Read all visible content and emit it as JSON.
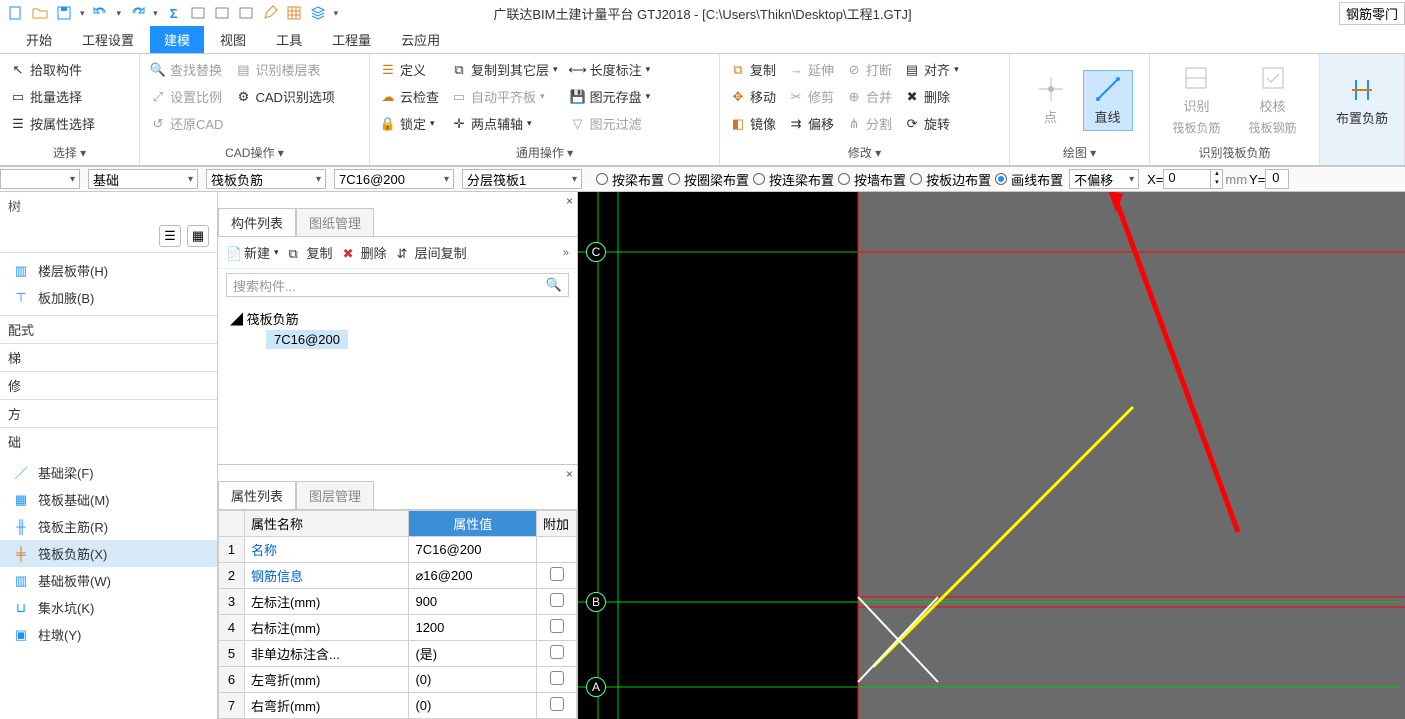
{
  "title": "广联达BIM土建计量平台 GTJ2018 - [C:\\Users\\Thikn\\Desktop\\工程1.GTJ]",
  "rightEdge": "钢筋零门",
  "mainTabs": [
    "开始",
    "工程设置",
    "建模",
    "视图",
    "工具",
    "工程量",
    "云应用"
  ],
  "activeMainTab": 2,
  "ribbon": {
    "select": {
      "label": "选择 ▾",
      "items": [
        "拾取构件",
        "批量选择",
        "按属性选择"
      ]
    },
    "cad": {
      "label": "CAD操作 ▾",
      "items": [
        "查找替换",
        "设置比例",
        "还原CAD",
        "识别楼层表",
        "CAD识别选项"
      ]
    },
    "common": {
      "label": "通用操作 ▾",
      "colA": [
        "定义",
        "云检查",
        "锁定"
      ],
      "colB": [
        "复制到其它层",
        "自动平齐板",
        "两点辅轴"
      ],
      "colC": [
        "长度标注",
        "图元存盘",
        "图元过滤"
      ]
    },
    "edit": {
      "label": "修改 ▾",
      "colA": [
        "复制",
        "移动",
        "镜像"
      ],
      "colB": [
        "延伸",
        "修剪",
        "偏移"
      ],
      "colC": [
        "打断",
        "合并",
        "分割"
      ],
      "colD": [
        "对齐",
        "删除",
        "旋转"
      ]
    },
    "draw": {
      "label": "绘图 ▾",
      "point": "点",
      "line": "直线"
    },
    "recog": {
      "label": "识别筏板负筋",
      "a": "识别",
      "asub": "筏板负筋",
      "b": "校核",
      "bsub": "筏板钢筋"
    },
    "place": {
      "label": "布置负筋"
    }
  },
  "selectorBar": {
    "d1": "",
    "d2": "基础",
    "d3": "筏板负筋",
    "d4": "7C16@200",
    "d5": "分层筏板1",
    "radios": [
      "按梁布置",
      "按圈梁布置",
      "按连梁布置",
      "按墙布置",
      "按板边布置",
      "画线布置"
    ],
    "radioSel": 5,
    "offsetSel": "不偏移",
    "xLabel": "X=",
    "xVal": "0",
    "unit": "mm",
    "yLabel": "Y=",
    "yVal": "0"
  },
  "leftPanel": {
    "header": "树",
    "section1": [
      "楼层板带(H)",
      "板加腋(B)"
    ],
    "stubs": [
      "配式",
      "梯",
      "修",
      "方",
      "础"
    ],
    "section2": [
      "基础梁(F)",
      "筏板基础(M)",
      "筏板主筋(R)",
      "筏板负筋(X)",
      "基础板带(W)",
      "集水坑(K)",
      "柱墩(Y)"
    ],
    "section2Sel": 3
  },
  "midPanel": {
    "tabA": "构件列表",
    "tabB": "图纸管理",
    "tool": [
      "新建",
      "复制",
      "删除",
      "层间复制"
    ],
    "searchPH": "搜索构件...",
    "group": "筏板负筋",
    "child": "7C16@200"
  },
  "propPanel": {
    "tabA": "属性列表",
    "tabB": "图层管理",
    "headers": {
      "name": "属性名称",
      "value": "属性值",
      "extra": "附加"
    },
    "rows": [
      {
        "i": "1",
        "n": "名称",
        "v": "7C16@200",
        "link": true,
        "chk": false
      },
      {
        "i": "2",
        "n": "钢筋信息",
        "v": "⌀16@200",
        "link": true,
        "chk": true
      },
      {
        "i": "3",
        "n": "左标注(mm)",
        "v": "900",
        "chk": true
      },
      {
        "i": "4",
        "n": "右标注(mm)",
        "v": "1200",
        "chk": true
      },
      {
        "i": "5",
        "n": "非单边标注含...",
        "v": "(是)",
        "chk": true
      },
      {
        "i": "6",
        "n": "左弯折(mm)",
        "v": "(0)",
        "chk": true
      },
      {
        "i": "7",
        "n": "右弯折(mm)",
        "v": "(0)",
        "chk": true
      }
    ]
  },
  "axes": [
    "C",
    "B",
    "A"
  ]
}
